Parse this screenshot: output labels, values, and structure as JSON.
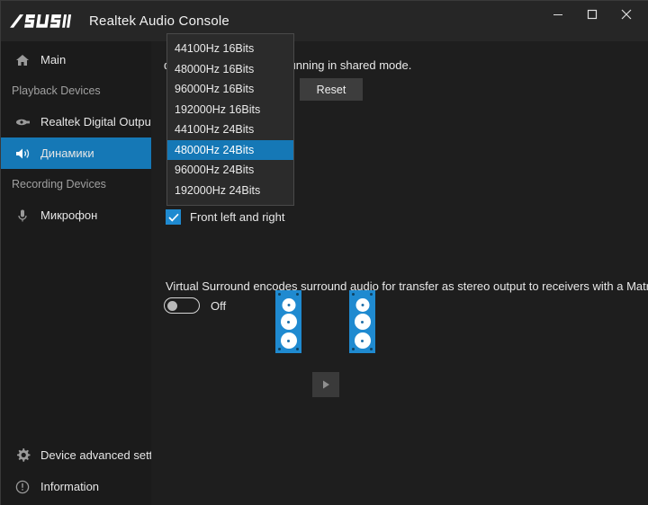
{
  "window": {
    "brand_logo": "/ISUS",
    "title": "Realtek Audio Console",
    "controls": {
      "minimize": "minimize-icon",
      "maximize": "maximize-icon",
      "close": "close-icon"
    }
  },
  "sidebar": {
    "top_items": [
      {
        "label": "Main",
        "icon": "home-icon",
        "selected": false
      }
    ],
    "sections": [
      {
        "header": "Playback Devices",
        "items": [
          {
            "label": "Realtek Digital Output",
            "icon": "spdif-icon",
            "selected": false
          },
          {
            "label": "Динамики",
            "icon": "speaker-icon",
            "selected": true
          }
        ]
      },
      {
        "header": "Recording Devices",
        "items": [
          {
            "label": "Микрофон",
            "icon": "microphone-icon",
            "selected": false
          }
        ]
      }
    ],
    "bottom_items": [
      {
        "label": "Device advanced settings",
        "icon": "gear-icon"
      },
      {
        "label": "Information",
        "icon": "info-icon"
      }
    ]
  },
  "main": {
    "shared_mode_text": "depth to be used when running in shared mode.",
    "reset_button": "Reset",
    "channel_config": {
      "label": "Front left and right",
      "checked": true
    },
    "virtual_surround": {
      "description": "Virtual Surround encodes surround audio for transfer as stereo output to receivers with a Matrix decoder.",
      "state": "Off",
      "enabled": false
    },
    "speaker_preview": {
      "left_speaker": "speaker-left",
      "right_speaker": "speaker-right",
      "play_button": "play-icon"
    }
  },
  "format_dropdown": {
    "open": true,
    "selected": "48000Hz 24Bits",
    "options": [
      "44100Hz 16Bits",
      "48000Hz 16Bits",
      "96000Hz 16Bits",
      "192000Hz 16Bits",
      "44100Hz 24Bits",
      "48000Hz 24Bits",
      "96000Hz 24Bits",
      "192000Hz 24Bits"
    ]
  },
  "colors": {
    "accent": "#1578b6",
    "speaker_blue": "#1f8ad0",
    "titlebar_bg": "#262626",
    "sidebar_bg": "#1b1b1b",
    "content_bg": "#1e1e1e"
  }
}
